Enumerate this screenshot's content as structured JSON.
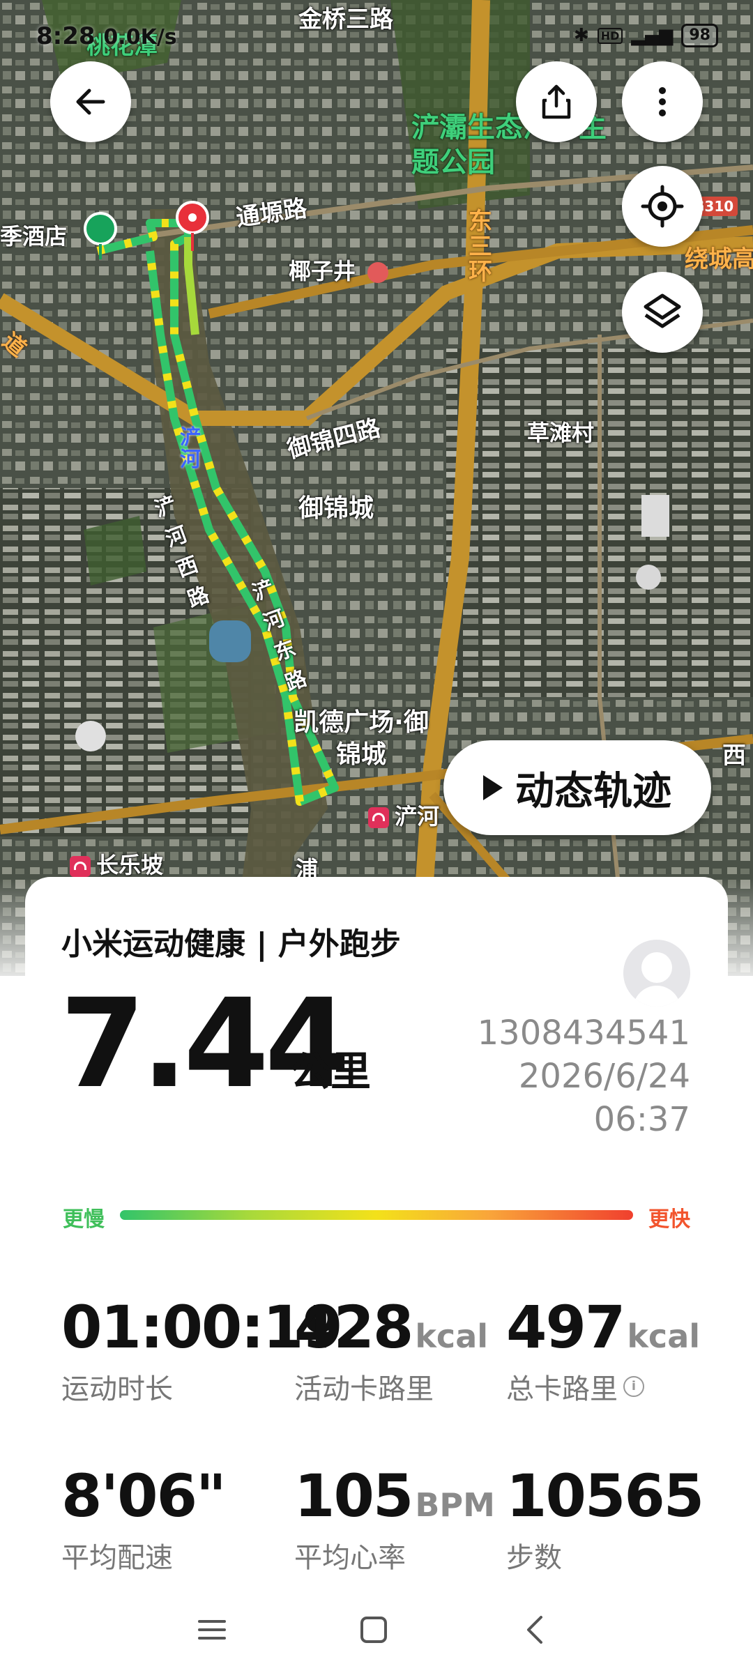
{
  "status_bar": {
    "time": "8:28",
    "net_speed": "0.0K/s",
    "icons": [
      "bluetooth-icon",
      "hd-icon",
      "signal-icon"
    ],
    "battery": "98"
  },
  "map": {
    "labels": {
      "jinqiao_road": "金桥三路",
      "taohua": "桃花潭",
      "park": "浐灞生态汽车主题公园",
      "tongyuan_road": "通塬路",
      "hotel": "季酒店",
      "yezijing": "椰子井",
      "dongsanhuan": "东三环",
      "raocheng": "绕城高",
      "yujin_4_road": "御锦四路",
      "caotan": "草滩村",
      "chanhe": "浐河",
      "chanhe_west_road": "浐河西路",
      "chanhe_east_road": "浐河东路",
      "yujincheng": "御锦城",
      "kaide_plaza": "凯德广场·御锦城",
      "metro_chanhe": "浐河",
      "metro_changlepo": "长乐坡",
      "xi": "西",
      "pu": "浦",
      "road_label": "道",
      "g310": "G310"
    },
    "route_colors": [
      "#32c46a",
      "#a7d93b",
      "#f3e11a"
    ],
    "start_color": "#17a35b",
    "end_color": "#e8303a"
  },
  "buttons": {
    "back_icon": "back-arrow-icon",
    "share_icon": "share-icon",
    "more_icon": "more-icon",
    "locate_icon": "locate-icon",
    "layers_icon": "layers-icon",
    "dynamic_track_label": "动态轨迹"
  },
  "card": {
    "title": "小米运动健康 | 户外跑步",
    "distance": "7.44",
    "distance_unit": "公里",
    "user_id": "1308434541",
    "date": "2026/6/24",
    "time": "06:37",
    "legend_slower": "更慢",
    "legend_faster": "更快",
    "stats": [
      {
        "value": "01:00:19",
        "unit": "",
        "label": "运动时长"
      },
      {
        "value": "428",
        "unit": "kcal",
        "label": "活动卡路里"
      },
      {
        "value": "497",
        "unit": "kcal",
        "label": "总卡路里"
      },
      {
        "value": "8'06\"",
        "unit": "",
        "label": "平均配速"
      },
      {
        "value": "105",
        "unit": "BPM",
        "label": "平均心率"
      },
      {
        "value": "10565",
        "unit": "",
        "label": "步数"
      }
    ]
  },
  "nav_bar": {
    "icons": [
      "menu-icon",
      "home-icon",
      "back-icon"
    ]
  }
}
